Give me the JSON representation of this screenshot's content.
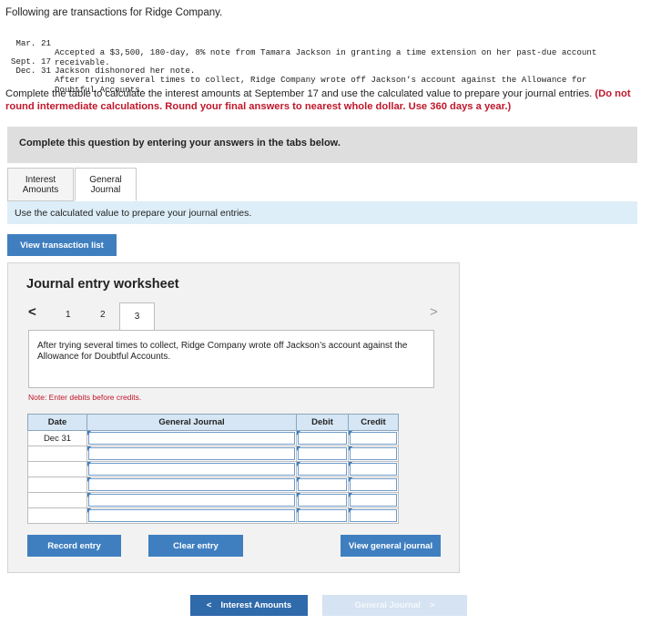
{
  "intro": "Following are transactions for Ridge Company.",
  "transactions": [
    {
      "date": "Mar. 21",
      "text": "Accepted a $3,500, 180-day, 8% note from Tamara Jackson in granting a time extension on her past-due account receivable."
    },
    {
      "date": "Sept. 17",
      "text": "Jackson dishonored her note."
    },
    {
      "date": "Dec. 31",
      "text": "After trying several times to collect, Ridge Company wrote off Jackson’s account against the Allowance for Doubtful Accounts."
    }
  ],
  "instructions": {
    "text": "Complete the table to calculate the interest amounts at September 17 and use the calculated value to prepare your journal entries.",
    "bold_red": "(Do not round intermediate calculations. Round your final answers to nearest whole dollar. Use 360 days a year.)"
  },
  "question_header": "Complete this question by entering your answers in the tabs below.",
  "tabs": [
    {
      "line1": "Interest",
      "line2": "Amounts"
    },
    {
      "line1": "General",
      "line2": "Journal"
    }
  ],
  "tab_instruction": "Use the calculated value to prepare your journal entries.",
  "view_transaction_list": "View transaction list",
  "worksheet": {
    "title": "Journal entry worksheet",
    "prev_arrow": "<",
    "next_arrow": ">",
    "steps": [
      "1",
      "2",
      "3"
    ],
    "current_step": "3",
    "description": "After trying several times to collect, Ridge Company wrote off Jackson’s account against the Allowance for Doubtful Accounts.",
    "note": "Note: Enter debits before credits.",
    "columns": {
      "date": "Date",
      "journal": "General Journal",
      "debit": "Debit",
      "credit": "Credit"
    },
    "rows": [
      {
        "date": "Dec 31",
        "account": "",
        "debit": "",
        "credit": ""
      },
      {
        "date": "",
        "account": "",
        "debit": "",
        "credit": ""
      },
      {
        "date": "",
        "account": "",
        "debit": "",
        "credit": ""
      },
      {
        "date": "",
        "account": "",
        "debit": "",
        "credit": ""
      },
      {
        "date": "",
        "account": "",
        "debit": "",
        "credit": ""
      },
      {
        "date": "",
        "account": "",
        "debit": "",
        "credit": ""
      }
    ],
    "record_entry": "Record entry",
    "clear_entry": "Clear entry",
    "view_general_journal": "View general journal"
  },
  "footer": {
    "prev_label": "Interest Amounts",
    "prev_arrow": "<",
    "next_label": "General Journal",
    "next_arrow": ">"
  },
  "colors": {
    "button_blue": "#3f7fc0",
    "dark_button": "#2f6aab",
    "disabled_button": "#d5e3f2",
    "red_text": "#c0172b"
  }
}
